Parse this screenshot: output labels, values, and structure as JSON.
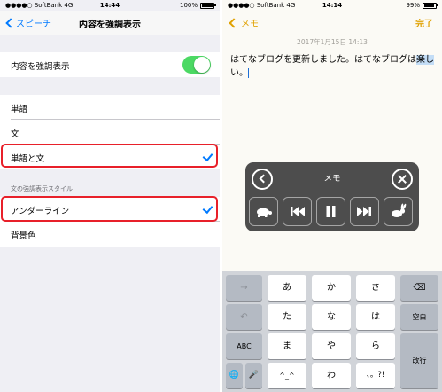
{
  "left_screen": {
    "status": {
      "carrier": "●●●●○ SoftBank  4G",
      "time": "14:44",
      "battery": "100%",
      "battery_fraction": 1.0
    },
    "nav": {
      "back_label": "スピーチ",
      "title": "内容を強調表示"
    },
    "highlight_content": {
      "label": "内容を強調表示",
      "enabled": true
    },
    "options": [
      {
        "label": "単語",
        "selected": false
      },
      {
        "label": "文",
        "selected": false
      },
      {
        "label": "単語と文",
        "selected": true
      }
    ],
    "style_section": {
      "header": "文の強調表示スタイル",
      "options": [
        {
          "label": "アンダーライン",
          "selected": true
        },
        {
          "label": "背景色",
          "selected": false
        }
      ]
    },
    "colors": {
      "accent": "#007aff",
      "toggle_on": "#4cd964",
      "highlight_ring": "#e8202a"
    }
  },
  "right_screen": {
    "status": {
      "carrier": "●●●●○ SoftBank  4G",
      "time": "14:14",
      "battery": "99%",
      "battery_fraction": 0.99
    },
    "nav": {
      "back_label": "メモ",
      "done_label": "完了"
    },
    "note": {
      "date": "2017年1月15日 14:13",
      "text_plain": "はてなブログを更新しました。はてなブログは",
      "text_selected": "楽し",
      "text_after": "い。"
    },
    "speak_controller": {
      "title": "メモ",
      "icons": [
        "chevron-left-icon",
        "close-icon",
        "turtle-icon",
        "rewind-icon",
        "pause-icon",
        "fast-forward-icon",
        "rabbit-icon"
      ]
    },
    "keyboard": {
      "rows": [
        [
          "→",
          "あ",
          "か",
          "さ",
          "⌫"
        ],
        [
          "↶",
          "た",
          "な",
          "は",
          "空白"
        ],
        [
          "ABC",
          "ま",
          "や",
          "ら",
          "改行"
        ],
        [
          "🌐",
          "🎤",
          "^_^",
          "わ",
          "、。?!"
        ]
      ],
      "sub_labels": {
        "ya": "",
        "wa": "",
        "mark": ""
      }
    },
    "colors": {
      "accent": "#e0a100",
      "selection": "#c3ddf6"
    }
  }
}
